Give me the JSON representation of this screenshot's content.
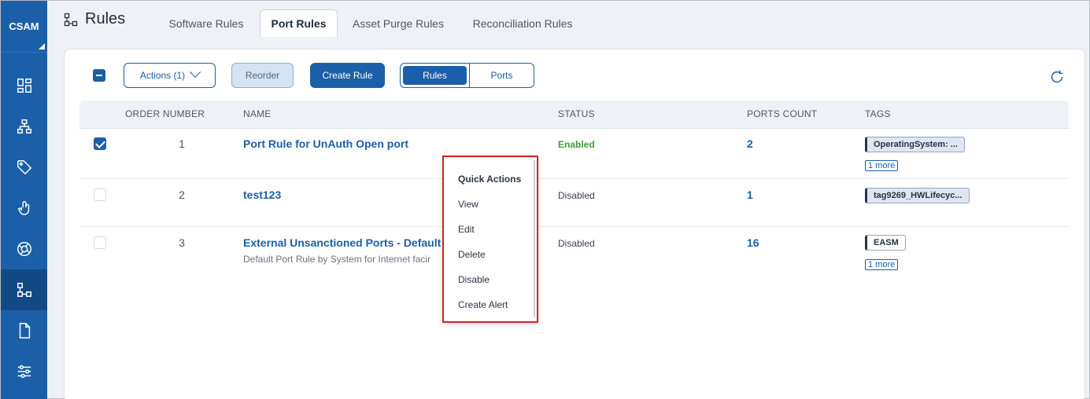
{
  "app": {
    "brand": "CSAM"
  },
  "sidebar": {
    "items": [
      {
        "icon": "dashboard-icon"
      },
      {
        "icon": "network-icon"
      },
      {
        "icon": "tag-icon"
      },
      {
        "icon": "touch-icon"
      },
      {
        "icon": "orbit-icon"
      },
      {
        "icon": "rules-icon",
        "active": true
      },
      {
        "icon": "document-icon"
      },
      {
        "icon": "sliders-icon"
      }
    ]
  },
  "header": {
    "title": "Rules",
    "tabs": [
      {
        "label": "Software Rules"
      },
      {
        "label": "Port Rules",
        "active": true
      },
      {
        "label": "Asset Purge Rules"
      },
      {
        "label": "Reconciliation Rules"
      }
    ]
  },
  "toolbar": {
    "actions_label": "Actions (1)",
    "reorder_label": "Reorder",
    "create_label": "Create Rule",
    "view_toggle": {
      "rules": "Rules",
      "ports": "Ports"
    }
  },
  "table": {
    "columns": [
      "ORDER NUMBER",
      "NAME",
      "STATUS",
      "PORTS COUNT",
      "TAGS"
    ],
    "rows": [
      {
        "checked": true,
        "order": "1",
        "name": "Port Rule for UnAuth Open port",
        "description": "",
        "status": "Enabled",
        "ports": "2",
        "tag": "OperatingSystem: ...",
        "more": "1 more"
      },
      {
        "checked": false,
        "order": "2",
        "name": "test123",
        "description": "",
        "status": "Disabled",
        "ports": "1",
        "tag": "tag9269_HWLifecyc...",
        "more": ""
      },
      {
        "checked": false,
        "order": "3",
        "name": "External Unsanctioned Ports - Default",
        "description": "Default Port Rule by System for Internet facir",
        "status": "Disabled",
        "ports": "16",
        "tag": "EASM",
        "more": "1 more"
      }
    ]
  },
  "quick_actions": {
    "title": "Quick Actions",
    "items": [
      "View",
      "Edit",
      "Delete",
      "Disable",
      "Create Alert"
    ]
  },
  "colors": {
    "primary": "#1b5fa8",
    "enabled": "#3f9a3a",
    "highlight": "#d61f26"
  }
}
